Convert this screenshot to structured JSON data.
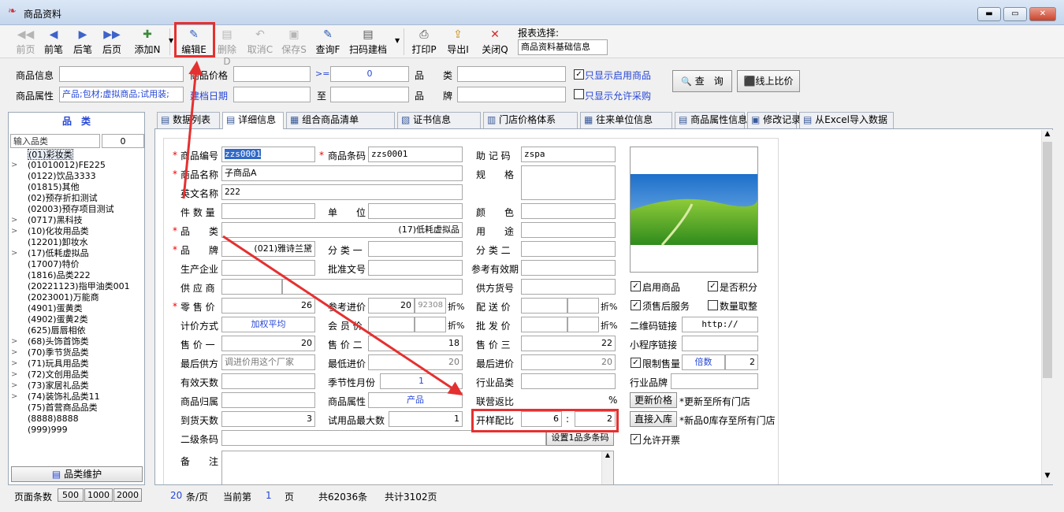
{
  "window": {
    "title": "商品资料",
    "minimize": "▬",
    "maximize": "▭",
    "close": "✕"
  },
  "toolbar": {
    "buttons": [
      {
        "label": "前页",
        "icon": "◀◀",
        "enabled": false
      },
      {
        "label": "前笔",
        "icon": "◀",
        "enabled": true
      },
      {
        "label": "后笔",
        "icon": "▶",
        "enabled": true
      },
      {
        "label": "后页",
        "icon": "▶▶",
        "enabled": true
      },
      {
        "label": "添加N",
        "icon": "✚",
        "enabled": true
      },
      {
        "label": "编辑E",
        "icon": "✎",
        "enabled": true
      },
      {
        "label": "删除D",
        "icon": "▤",
        "enabled": false
      },
      {
        "label": "取消C",
        "icon": "↶",
        "enabled": false
      },
      {
        "label": "保存S",
        "icon": "▣",
        "enabled": false
      },
      {
        "label": "查询F",
        "icon": "✎",
        "enabled": true
      },
      {
        "label": "扫码建档",
        "icon": "▤",
        "enabled": true
      },
      {
        "label": "打印P",
        "icon": "⎙",
        "enabled": true
      },
      {
        "label": "导出I",
        "icon": "⇪",
        "enabled": true
      },
      {
        "label": "关闭Q",
        "icon": "✕",
        "enabled": true
      }
    ],
    "report_label": "报表选择:",
    "report_value": "商品资料基础信息"
  },
  "search": {
    "info_label": "商品信息",
    "info_value": "",
    "price_label": "商品价格",
    "price_value": "",
    "op": ">=",
    "op_value": "0",
    "category_label": "品　　类",
    "category_value": "",
    "only_enabled": "只显示启用商品",
    "query_btn": "查　询",
    "compare_btn": "线上比价",
    "attr_label": "商品属性",
    "attr_value": "产品;包材;虚拟商品;试用装;",
    "date_label": "建档日期",
    "date_from": "",
    "to": "至",
    "date_to": "",
    "brand_label": "品　　牌",
    "brand_value": "",
    "only_purchase": "只显示允许采购"
  },
  "tree": {
    "header": "品　类",
    "filter_placeholder": "输入品类",
    "count": "0",
    "items": [
      {
        "label": "(01)彩妆类",
        "exp": false
      },
      {
        "label": "(01010012)FE225",
        "exp": true
      },
      {
        "label": "(0122)饮品3333",
        "exp": false
      },
      {
        "label": "(01815)其他",
        "exp": false
      },
      {
        "label": "(02)预存折扣测试",
        "exp": false
      },
      {
        "label": "(02003)预存项目测试",
        "exp": false
      },
      {
        "label": "(0717)黑科技",
        "exp": true
      },
      {
        "label": "(10)化妆用品类",
        "exp": true
      },
      {
        "label": "(12201)卸妆水",
        "exp": false
      },
      {
        "label": "(17)低耗虚拟品",
        "exp": true
      },
      {
        "label": "(17007)特价",
        "exp": false
      },
      {
        "label": "(1816)品类222",
        "exp": false
      },
      {
        "label": "(20221123)指甲油类001",
        "exp": false
      },
      {
        "label": "(2023001)万能商",
        "exp": false
      },
      {
        "label": "(4901)蛋黄类",
        "exp": false
      },
      {
        "label": "(4902)蛋黄2类",
        "exp": false
      },
      {
        "label": "(625)唇唇相依",
        "exp": false
      },
      {
        "label": "(68)头饰首饰类",
        "exp": true
      },
      {
        "label": "(70)季节货品类",
        "exp": true
      },
      {
        "label": "(71)玩具用品类",
        "exp": true
      },
      {
        "label": "(72)文创用品类",
        "exp": true
      },
      {
        "label": "(73)家居礼品类",
        "exp": true
      },
      {
        "label": "(74)装饰礼品类11",
        "exp": true
      },
      {
        "label": "(75)首营商品品类",
        "exp": false
      },
      {
        "label": "(8888)8888",
        "exp": false
      },
      {
        "label": "(999)999",
        "exp": false
      }
    ],
    "maintain_btn": "品类维护"
  },
  "tabs": [
    "数据列表",
    "详细信息",
    "组合商品清单",
    "证书信息",
    "门店价格体系",
    "往来单位信息",
    "商品属性信息",
    "修改记录",
    "从Excel导入数据"
  ],
  "form": {
    "code_label": "商品编号",
    "code": "zzs0001",
    "barcode_label": "商品条码",
    "barcode": "zzs0001",
    "mnemonic_label": "助 记 码",
    "mnemonic": "zspa",
    "name_label": "商品名称",
    "name": "子商品A",
    "spec_label": "规　　格",
    "en_label": "英文名称",
    "en": "222",
    "pieces_label": "件 数 量",
    "unit_label": "单　　位",
    "color_label": "颜　　色",
    "category_label": "品　　类",
    "category": "(17)低耗虚拟品",
    "usage_label": "用　　途",
    "brand_label": "品　　牌",
    "brand": "(021)雅诗兰黛",
    "class1_label": "分 类 一",
    "class2_label": "分 类 二",
    "maker_label": "生产企业",
    "approval_label": "批准文号",
    "validity_label": "参考有效期",
    "supplier_label": "供 应 商",
    "supplier_code_label": "供方货号",
    "retail_label": "零 售 价",
    "retail": "26",
    "ref_cost_label": "参考进价",
    "ref_cost": "20",
    "ref_cost2": "92308",
    "disc": "折%",
    "dist_label": "配 送 价",
    "pricing_label": "计价方式",
    "pricing": "加权平均",
    "member_label": "会 员 价",
    "wholesale_label": "批 发 价",
    "price1_label": "售 价 一",
    "price1": "20",
    "price2_label": "售 价 二",
    "price2": "18",
    "price3_label": "售 价 三",
    "price3": "22",
    "last_supplier_label": "最后供方",
    "last_supplier": "调进价用这个厂家",
    "min_cost_label": "最低进价",
    "min_cost": "20",
    "last_cost_label": "最后进价",
    "last_cost": "20",
    "valid_days_label": "有效天数",
    "season_label": "季节性月份",
    "season": "1",
    "industry_label": "行业品类",
    "belong_label": "商品归属",
    "attr_label": "商品属性",
    "attr": "产品",
    "joint_label": "联营返比",
    "pct": "%",
    "arrive_label": "到货天数",
    "arrive": "3",
    "trial_max_label": "试用品最大数",
    "trial_max": "1",
    "ratio_label": "开样配比",
    "ratio_a": "6",
    "colon": ":",
    "ratio_b": "2",
    "sub_barcode_label": "二级条码",
    "multi_barcode_btn": "设置1品多条码",
    "note_label": "备　　注"
  },
  "right": {
    "enable": "启用商品",
    "points": "是否积分",
    "aftersale": "须售后服务",
    "qty_adjust": "数量取整",
    "qr_label": "二维码链接",
    "qr": "http://",
    "mini_label": "小程序链接",
    "limit_label": "限制售量",
    "limit_mode": "倍数",
    "limit_value": "2",
    "ind_brand_label": "行业品牌",
    "update_price_btn": "更新价格",
    "update_price_note": "*更新至所有门店",
    "direct_btn": "直接入库",
    "direct_note": "*新品0库存至所有门店",
    "allow_invoice": "允许开票"
  },
  "status": {
    "page_size_label": "页面条数",
    "sizes": [
      "500",
      "1000",
      "2000"
    ],
    "per_page": "20",
    "per_page_unit": "条/页",
    "current_label": "当前第",
    "current": "1",
    "page_unit": "页",
    "total_records": "共62036条",
    "total_pages": "共计3102页"
  },
  "colors": {
    "highlight": "#e53030",
    "accent_blue": "#2646d6",
    "selection": "#3169c6"
  }
}
